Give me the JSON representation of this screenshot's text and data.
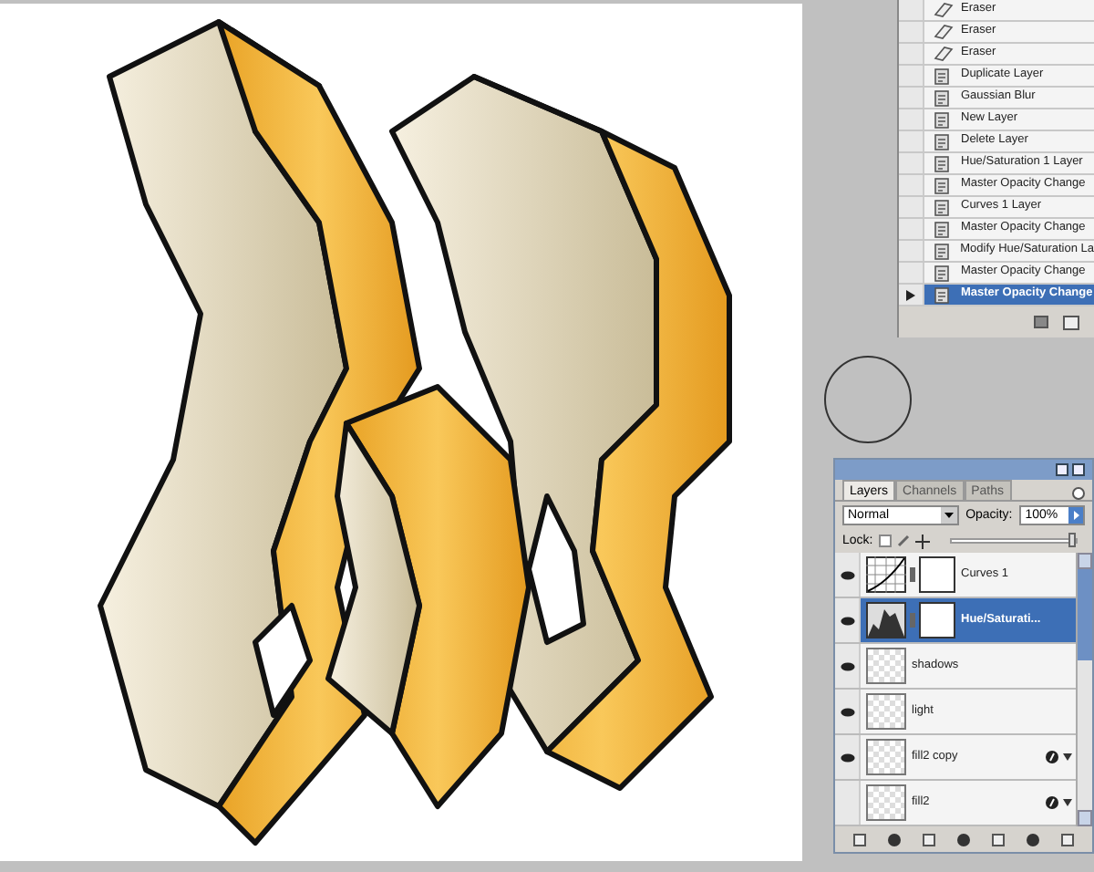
{
  "history": {
    "items": [
      {
        "label": "Eraser",
        "kind": "eraser",
        "selected": false
      },
      {
        "label": "Eraser",
        "kind": "eraser",
        "selected": false
      },
      {
        "label": "Eraser",
        "kind": "eraser",
        "selected": false
      },
      {
        "label": "Duplicate Layer",
        "kind": "doc",
        "selected": false
      },
      {
        "label": "Gaussian Blur",
        "kind": "doc",
        "selected": false
      },
      {
        "label": "New Layer",
        "kind": "doc",
        "selected": false
      },
      {
        "label": "Delete Layer",
        "kind": "doc",
        "selected": false
      },
      {
        "label": "Hue/Saturation 1 Layer",
        "kind": "doc",
        "selected": false
      },
      {
        "label": "Master Opacity Change",
        "kind": "doc",
        "selected": false
      },
      {
        "label": "Curves 1 Layer",
        "kind": "doc",
        "selected": false
      },
      {
        "label": "Master Opacity Change",
        "kind": "doc",
        "selected": false
      },
      {
        "label": "Modify Hue/Saturation La",
        "kind": "doc",
        "selected": false
      },
      {
        "label": "Master Opacity Change",
        "kind": "doc",
        "selected": false
      },
      {
        "label": "Master Opacity Change",
        "kind": "doc",
        "selected": true
      }
    ]
  },
  "layers_panel": {
    "tabs": [
      {
        "label": "Layers",
        "selected": true
      },
      {
        "label": "Channels",
        "selected": false
      },
      {
        "label": "Paths",
        "selected": false
      }
    ],
    "blend_mode": "Normal",
    "opacity_label": "Opacity:",
    "opacity": "100%",
    "opacity_slider": {
      "level": 1
    },
    "lock_label": "Lock:",
    "layers": [
      {
        "name": "Curves 1",
        "kind": "curves",
        "visible": true,
        "selected": false,
        "effects": false
      },
      {
        "name": "Hue/Saturati...",
        "kind": "hue",
        "visible": true,
        "selected": true,
        "effects": false
      },
      {
        "name": "shadows",
        "kind": "pixel",
        "visible": true,
        "selected": false,
        "effects": false
      },
      {
        "name": "light",
        "kind": "pixel",
        "visible": true,
        "selected": false,
        "effects": false
      },
      {
        "name": "fill2 copy",
        "kind": "pixel",
        "visible": true,
        "selected": false,
        "effects": true
      },
      {
        "name": "fill2",
        "kind": "pixel",
        "visible": false,
        "selected": false,
        "effects": true
      }
    ]
  }
}
